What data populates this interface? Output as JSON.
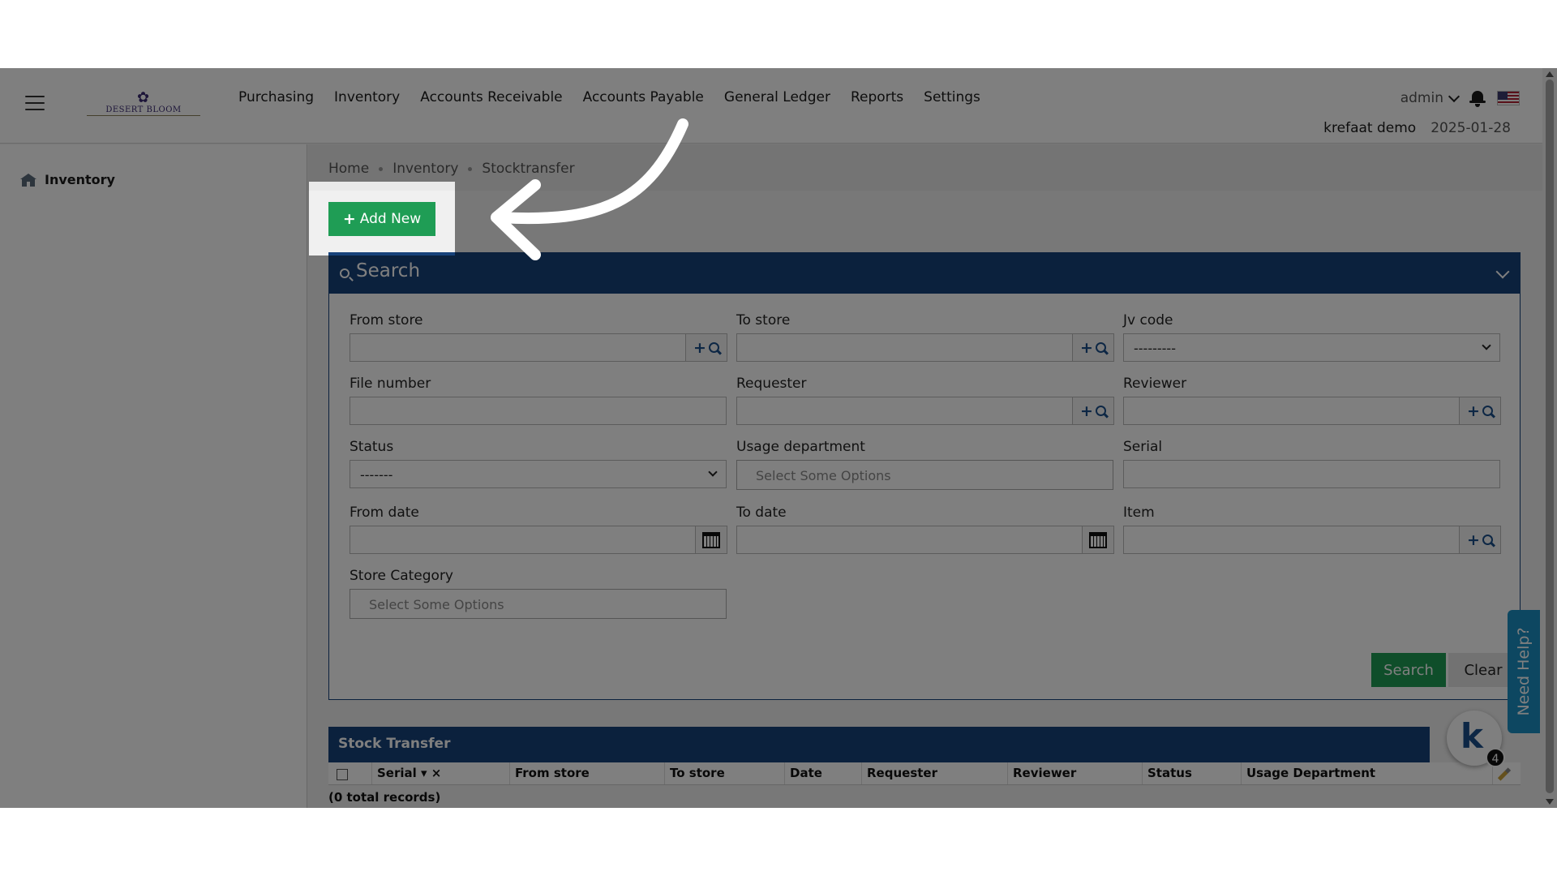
{
  "header": {
    "logo_text": "DESERT BLOOM",
    "nav": [
      "Purchasing",
      "Inventory",
      "Accounts Receivable",
      "Accounts Payable",
      "General Ledger",
      "Reports",
      "Settings"
    ],
    "user": "admin",
    "company": "krefaat demo",
    "date": "2025-01-28",
    "icons": [
      "hamburger-menu-icon",
      "chevron-down-icon",
      "bell-icon",
      "us-flag-icon"
    ]
  },
  "sidebar": {
    "items": [
      {
        "label": "Inventory",
        "icon": "building-icon"
      }
    ]
  },
  "breadcrumb": [
    "Home",
    "Inventory",
    "Stocktransfer"
  ],
  "add_new_label": "Add New",
  "search_panel": {
    "title": "Search",
    "fields": {
      "from_store": {
        "label": "From store",
        "value": ""
      },
      "to_store": {
        "label": "To store",
        "value": ""
      },
      "jv_code": {
        "label": "Jv code",
        "value": "---------"
      },
      "file_number": {
        "label": "File number",
        "value": ""
      },
      "requester": {
        "label": "Requester",
        "value": ""
      },
      "reviewer": {
        "label": "Reviewer",
        "value": ""
      },
      "status": {
        "label": "Status",
        "value": "-------"
      },
      "usage_department": {
        "label": "Usage department",
        "placeholder": "Select Some Options"
      },
      "serial": {
        "label": "Serial",
        "value": ""
      },
      "from_date": {
        "label": "From date",
        "value": ""
      },
      "to_date": {
        "label": "To date",
        "value": ""
      },
      "item": {
        "label": "Item",
        "value": ""
      },
      "store_category": {
        "label": "Store Category",
        "placeholder": "Select Some Options"
      }
    },
    "search_label": "Search",
    "clear_label": "Clear"
  },
  "grid": {
    "title": "Stock Transfer",
    "columns": [
      "Serial",
      "From store",
      "To store",
      "Date",
      "Requester",
      "Reviewer",
      "Status",
      "Usage Department"
    ],
    "footer": "(0 total records)"
  },
  "help": {
    "tab_label": "Need Help?",
    "widget_badge": "4"
  },
  "colors": {
    "brand_blue": "#17427a",
    "primary_green": "#1f9d55",
    "help_blue": "#1b8fc2"
  }
}
